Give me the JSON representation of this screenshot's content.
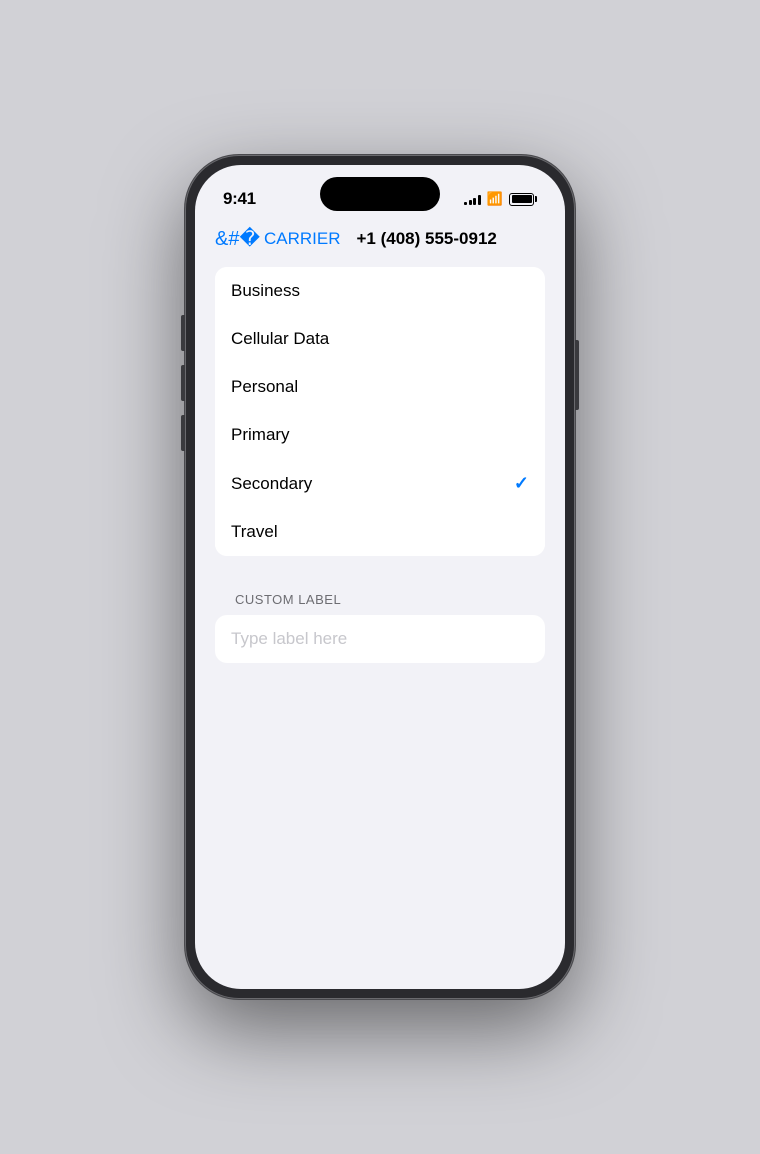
{
  "status_bar": {
    "time": "9:41"
  },
  "nav": {
    "back_label": "CARRIER",
    "title": "+1 (408) 555-0912"
  },
  "list": {
    "items": [
      {
        "label": "Business",
        "selected": false
      },
      {
        "label": "Cellular Data",
        "selected": false
      },
      {
        "label": "Personal",
        "selected": false
      },
      {
        "label": "Primary",
        "selected": false
      },
      {
        "label": "Secondary",
        "selected": true
      },
      {
        "label": "Travel",
        "selected": false
      }
    ]
  },
  "custom_label": {
    "section_header": "CUSTOM LABEL",
    "placeholder": "Type label here"
  },
  "colors": {
    "accent": "#007aff",
    "checkmark": "#007aff"
  }
}
